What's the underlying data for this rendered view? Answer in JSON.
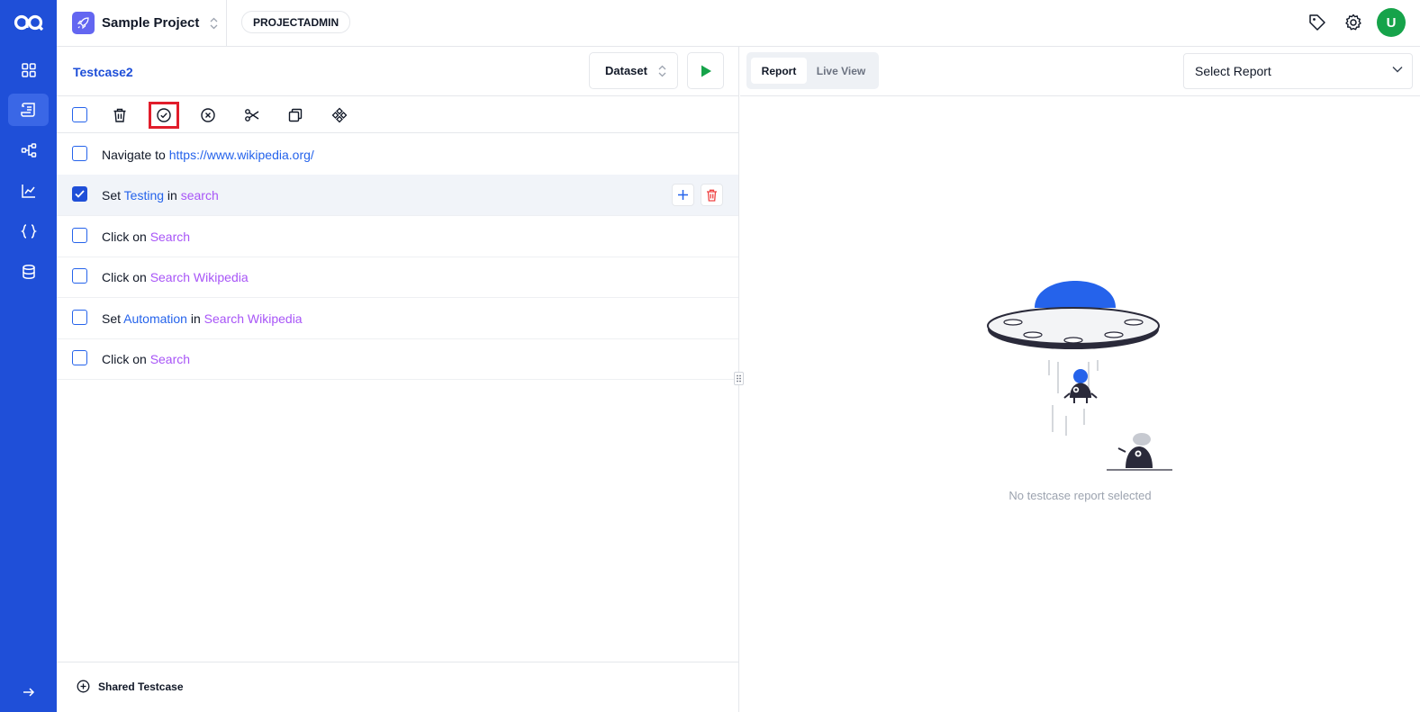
{
  "colors": {
    "brand": "#1f4fd8",
    "accent": "#2563eb",
    "target": "#a855f7",
    "run": "#16a34a",
    "highlight": "#e11d2b",
    "delete": "#ef4444"
  },
  "sidebar": {
    "items": [
      {
        "icon": "dashboard-icon"
      },
      {
        "icon": "testcases-icon",
        "active": true
      },
      {
        "icon": "workflow-icon"
      },
      {
        "icon": "reports-chart-icon"
      },
      {
        "icon": "variables-braces-icon"
      },
      {
        "icon": "database-icon"
      }
    ],
    "expand_icon": "arrow-right-icon"
  },
  "topbar": {
    "project_name": "Sample Project",
    "role": "PROJECTADMIN",
    "avatar_letter": "U"
  },
  "testcase": {
    "title": "Testcase2",
    "dataset_label": "Dataset"
  },
  "toolbar": {
    "tools": [
      "select-all-checkbox",
      "delete-icon",
      "enable-check-icon",
      "disable-x-icon",
      "cut-scissors-icon",
      "copy-icon",
      "component-icon"
    ],
    "highlighted": "enable-check-icon"
  },
  "steps": [
    {
      "checked": false,
      "parts": [
        {
          "t": "Navigate to ",
          "k": "kw"
        },
        {
          "t": "https://www.wikipedia.org/",
          "k": "url"
        }
      ]
    },
    {
      "checked": true,
      "parts": [
        {
          "t": "Set ",
          "k": "kw"
        },
        {
          "t": "Testing",
          "k": "val"
        },
        {
          "t": " in ",
          "k": "kw"
        },
        {
          "t": "search",
          "k": "tgt"
        }
      ]
    },
    {
      "checked": false,
      "parts": [
        {
          "t": "Click on ",
          "k": "kw"
        },
        {
          "t": "Search",
          "k": "tgt"
        }
      ]
    },
    {
      "checked": false,
      "parts": [
        {
          "t": "Click on ",
          "k": "kw"
        },
        {
          "t": "Search Wikipedia",
          "k": "tgt"
        }
      ]
    },
    {
      "checked": false,
      "parts": [
        {
          "t": "Set ",
          "k": "kw"
        },
        {
          "t": "Automation",
          "k": "val"
        },
        {
          "t": " in ",
          "k": "kw"
        },
        {
          "t": "Search Wikipedia",
          "k": "tgt"
        }
      ]
    },
    {
      "checked": false,
      "parts": [
        {
          "t": "Click on ",
          "k": "kw"
        },
        {
          "t": "Search",
          "k": "tgt"
        }
      ]
    }
  ],
  "shared_testcase_label": "Shared Testcase",
  "report": {
    "tabs": [
      {
        "label": "Report",
        "active": true
      },
      {
        "label": "Live View",
        "active": false
      }
    ],
    "select_placeholder": "Select Report",
    "empty_message": "No testcase report selected"
  }
}
